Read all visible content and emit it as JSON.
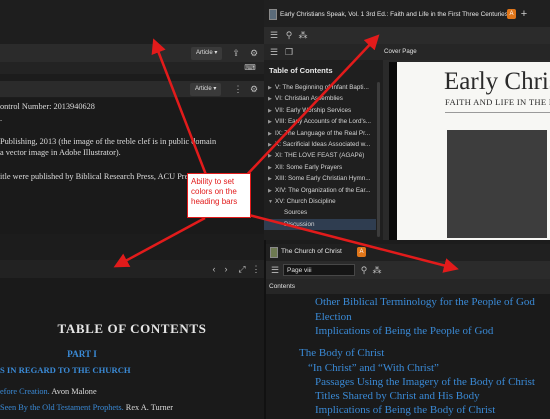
{
  "colors": {
    "accent_orange": "#e0761a",
    "annotation_red": "#e21b1b",
    "link_blue": "#3a8ad6",
    "highlight_row": "#2f3d50"
  },
  "top_right_window": {
    "tab_title": "Early Christians Speak, Vol. 1 3rd Ed.: Faith and Life in the First Three Centuries",
    "tab_badge": "A",
    "new_tab_symbol": "+"
  },
  "top_left": {
    "article_dropdown": "Article ▾",
    "article_dropdown_2": "Article ▾",
    "text_lines": [
      "ontrol Number: 2013940628",
      ".",
      "",
      "Publishing, 2013 (the image of the treble clef is in public domain",
      "a vector image in Adobe Illustrator).",
      "",
      "itle were published by Biblical Research Press, ACU Press, and Star"
    ]
  },
  "toc_panel": {
    "heading": "Table of Contents",
    "cover_label": "Cover Page",
    "items": [
      "V: The Beginning of Infant Bapti...",
      "VI: Christian Assemblies",
      "VII: Early Worship Services",
      "VIII: Early Accounts of the Lord's...",
      "IX: The Language of the Real Pr...",
      "X: Sacrificial Ideas Associated w...",
      "XI: THE LOVE FEAST (AGAPē)",
      "XII: Some Early Prayers",
      "XIII: Some Early Christian Hymn...",
      "XIV: The Organization of the Ear...",
      "XV: Church Discipline",
      "Sources",
      "Discussion"
    ]
  },
  "cover": {
    "title": "Early Chris",
    "subtitle": "FAITH AND LIFE IN THE FIRST"
  },
  "annotation": {
    "text": "Ability to set colors on the heading bars"
  },
  "bottom_right_window": {
    "tab_title": "The Church of Christ",
    "tab_badge": "A",
    "page_input": "Page viii",
    "contents_label": "Contents",
    "lines": [
      "Other Biblical Terminology for the People of God",
      "Election",
      "Implications of Being the People of God",
      "The Body of Christ",
      "“In Christ” and “With Christ”",
      "Passages Using the Imagery of the Body of Christ",
      "Titles Shared by Christ and His Body",
      "Implications of Being the Body of Christ"
    ]
  },
  "bottom_left": {
    "toc_title": "TABLE OF CONTENTS",
    "part": "PART I",
    "part_subtitle": "S IN REGARD TO THE CHURCH",
    "line1_link": "efore Creation.",
    "line1_rest": " Avon Malone",
    "line2_link": "Seen By the Old Testament Prophets.",
    "line2_rest": " Rex A. Turner"
  }
}
